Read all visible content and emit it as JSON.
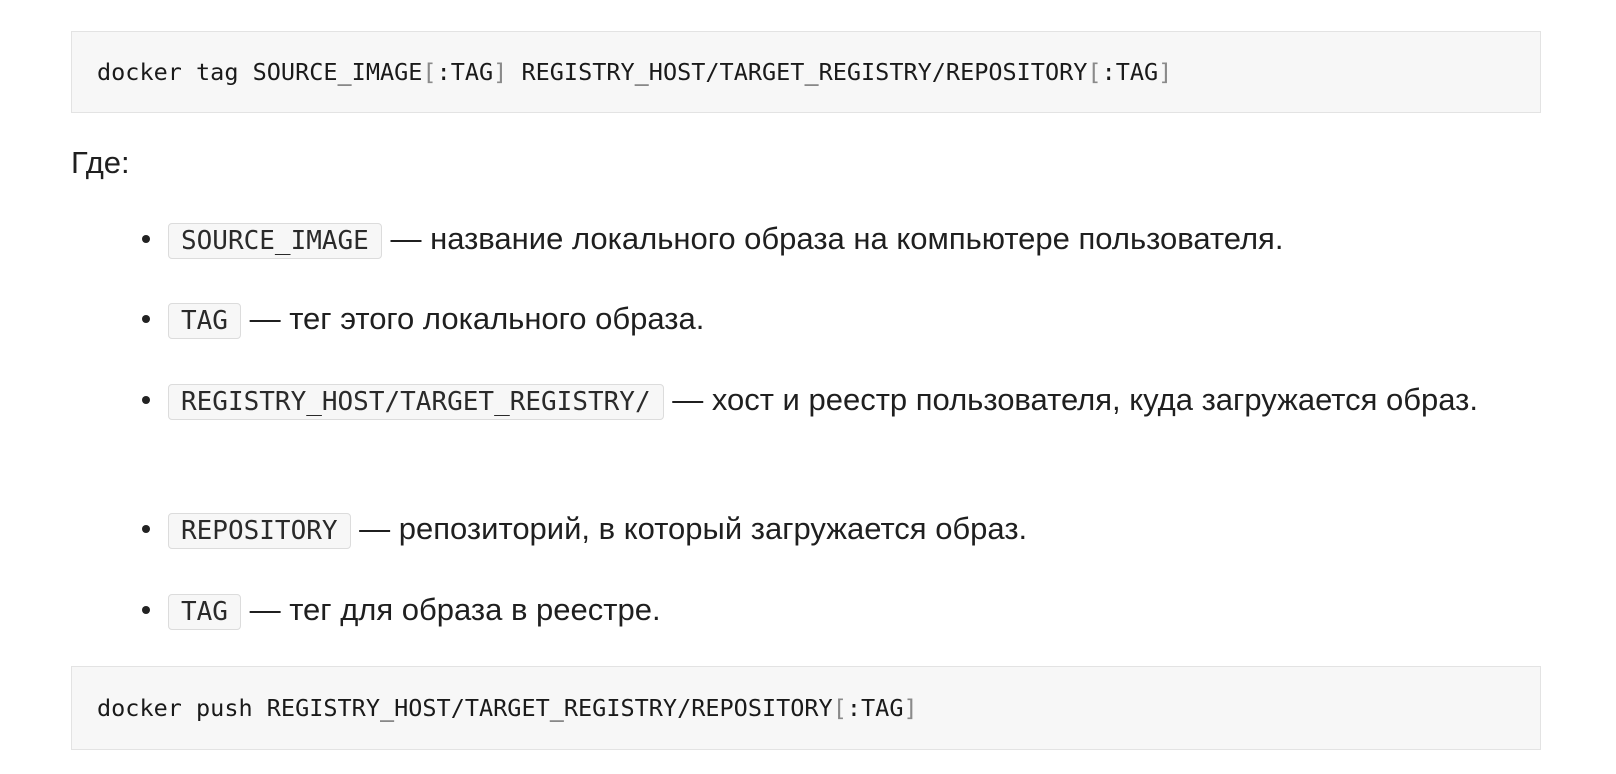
{
  "code_blocks": [
    {
      "before": "docker tag SOURCE_IMAGE",
      "bracket_open": "[",
      "middle": ":TAG",
      "bracket_close": "]",
      "after": " REGISTRY_HOST/TARGET_REGISTRY/REPOSITORY",
      "bracket_open_2": "[",
      "middle_2": ":TAG",
      "bracket_close_2": "]"
    },
    {
      "before": "docker push REGISTRY_HOST/TARGET_REGISTRY/REPOSITORY",
      "bracket_open": "[",
      "middle": ":TAG",
      "bracket_close": "]"
    }
  ],
  "where_label": "Где:",
  "items": [
    {
      "code": "SOURCE_IMAGE",
      "text": " — название локального образа на компьютере пользователя."
    },
    {
      "code": "TAG",
      "text": " — тег этого локального образа."
    },
    {
      "code": "REGISTRY_HOST/TARGET_REGISTRY/",
      "text": " — хост и реестр пользователя, куда загружается образ."
    },
    {
      "code": "REPOSITORY",
      "text": " — репозиторий, в который загружается образ."
    },
    {
      "code": "TAG",
      "text": " — тег для образа в реестре."
    }
  ]
}
